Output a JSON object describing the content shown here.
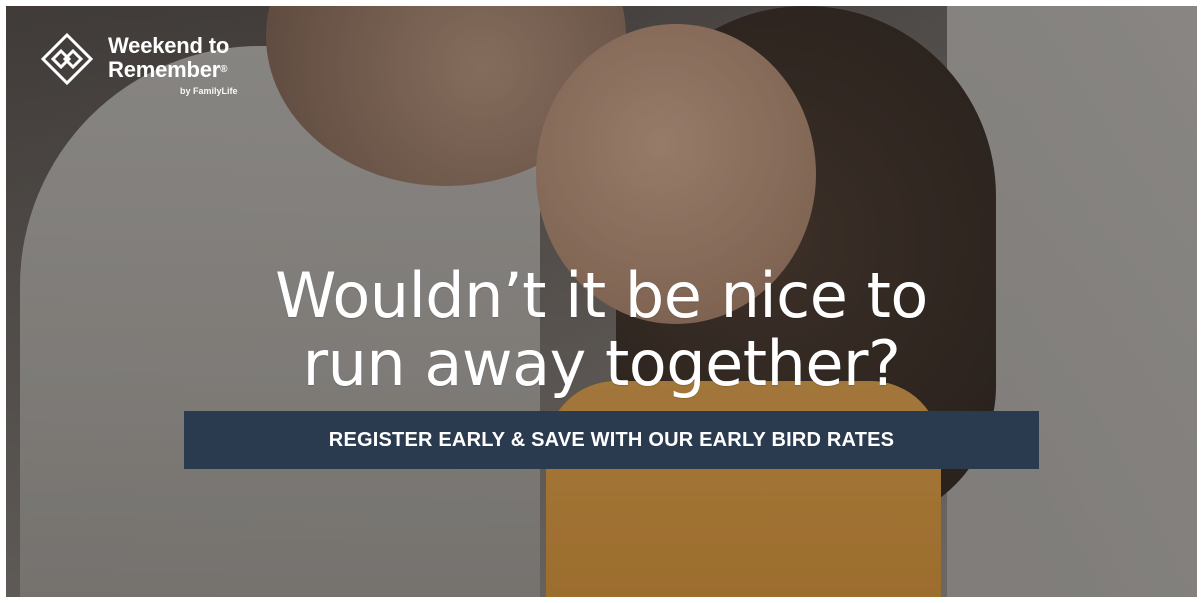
{
  "logo": {
    "title_line1": "Weekend to",
    "title_line2": "Remember",
    "registered_mark": "®",
    "byline": "by FamilyLife",
    "icon": "interlocking-diamond-icon"
  },
  "headline": {
    "line1": "Wouldn’t it be nice to",
    "line2": "run away together?"
  },
  "cta": {
    "label": "REGISTER EARLY & SAVE WITH OUR EARLY BIRD RATES"
  },
  "colors": {
    "cta_background": "#2a3b50",
    "text": "#ffffff"
  }
}
